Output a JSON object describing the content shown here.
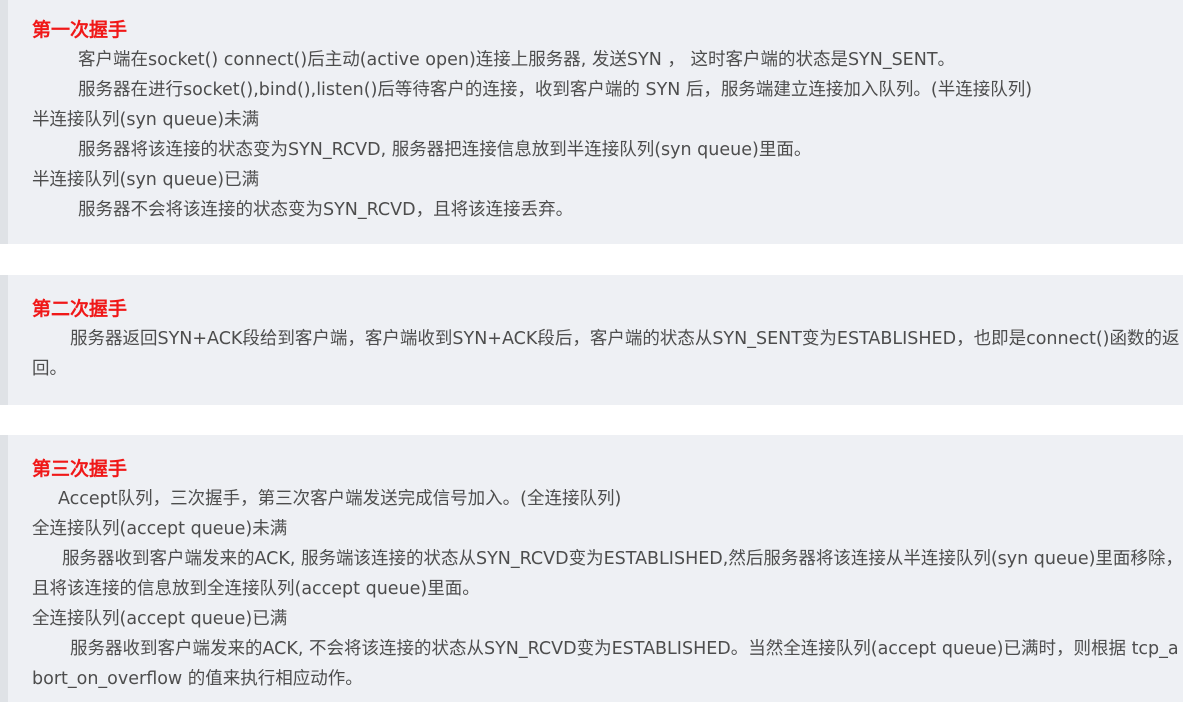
{
  "section1": {
    "heading": "第一次握手",
    "line1": "客户端在socket() connect()后主动(active open)连接上服务器, 发送SYN ， 这时客户端的状态是SYN_SENT。",
    "line2": "服务器在进行socket(),bind(),listen()后等待客户的连接，收到客户端的 SYN 后，服务端建立连接加入队列。(半连接队列)",
    "case1_title": "半连接队列(syn queue)未满",
    "case1_body": "服务器将该连接的状态变为SYN_RCVD, 服务器把连接信息放到半连接队列(syn queue)里面。",
    "case2_title": "半连接队列(syn queue)已满",
    "case2_body": "服务器不会将该连接的状态变为SYN_RCVD，且将该连接丢弃。"
  },
  "section2": {
    "heading": "第二次握手",
    "body": "服务器返回SYN+ACK段给到客户端，客户端收到SYN+ACK段后，客户端的状态从SYN_SENT变为ESTABLISHED，也即是connect()函数的返回。"
  },
  "section3": {
    "heading": "第三次握手",
    "line1": "Accept队列，三次握手，第三次客户端发送完成信号加入。(全连接队列)",
    "case1_title": "全连接队列(accept queue)未满",
    "case1_body": "服务器收到客户端发来的ACK, 服务端该连接的状态从SYN_RCVD变为ESTABLISHED,然后服务器将该连接从半连接队列(syn queue)里面移除，且将该连接的信息放到全连接队列(accept queue)里面。",
    "case2_title": "全连接队列(accept queue)已满",
    "case2_body": "服务器收到客户端发来的ACK, 不会将该连接的状态从SYN_RCVD变为ESTABLISHED。当然全连接队列(accept queue)已满时，则根据 tcp_abort_on_overflow 的值来执行相应动作。"
  }
}
